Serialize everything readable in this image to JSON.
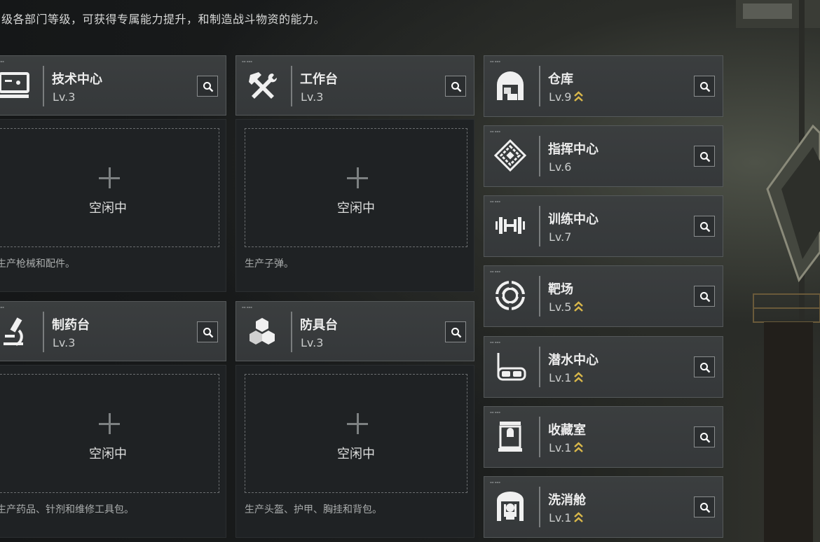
{
  "intro_text": "级各部门等级，可获得专属能力提升，和制造战斗物资的能力。",
  "idle_label": "空闲中",
  "workshops": [
    {
      "name": "技术中心",
      "level": "Lv.3",
      "desc": "生产枪械和配件。",
      "icon": "computer-terminal-icon"
    },
    {
      "name": "工作台",
      "level": "Lv.3",
      "desc": "生产子弹。",
      "icon": "hammer-wrench-icon"
    },
    {
      "name": "制药台",
      "level": "Lv.3",
      "desc": "生产药品、针剂和维修工具包。",
      "icon": "microscope-icon"
    },
    {
      "name": "防具台",
      "level": "Lv.3",
      "desc": "生产头盔、护甲、胸挂和背包。",
      "icon": "armor-blocks-icon"
    }
  ],
  "facilities": [
    {
      "name": "仓库",
      "level": "Lv.9",
      "upgradable": true,
      "icon": "warehouse-icon"
    },
    {
      "name": "指挥中心",
      "level": "Lv.6",
      "upgradable": false,
      "icon": "command-chip-icon"
    },
    {
      "name": "训练中心",
      "level": "Lv.7",
      "upgradable": false,
      "icon": "dumbbell-icon"
    },
    {
      "name": "靶场",
      "level": "Lv.5",
      "upgradable": true,
      "icon": "target-icon"
    },
    {
      "name": "潜水中心",
      "level": "Lv.1",
      "upgradable": true,
      "icon": "diving-mask-icon"
    },
    {
      "name": "收藏室",
      "level": "Lv.1",
      "upgradable": true,
      "icon": "display-case-icon"
    },
    {
      "name": "洗消舱",
      "level": "Lv.1",
      "upgradable": true,
      "icon": "decontamination-icon"
    }
  ],
  "colors": {
    "upgrade_arrow": "#d8b64a",
    "panel": "#3a3d3f",
    "body": "#1f2224"
  }
}
